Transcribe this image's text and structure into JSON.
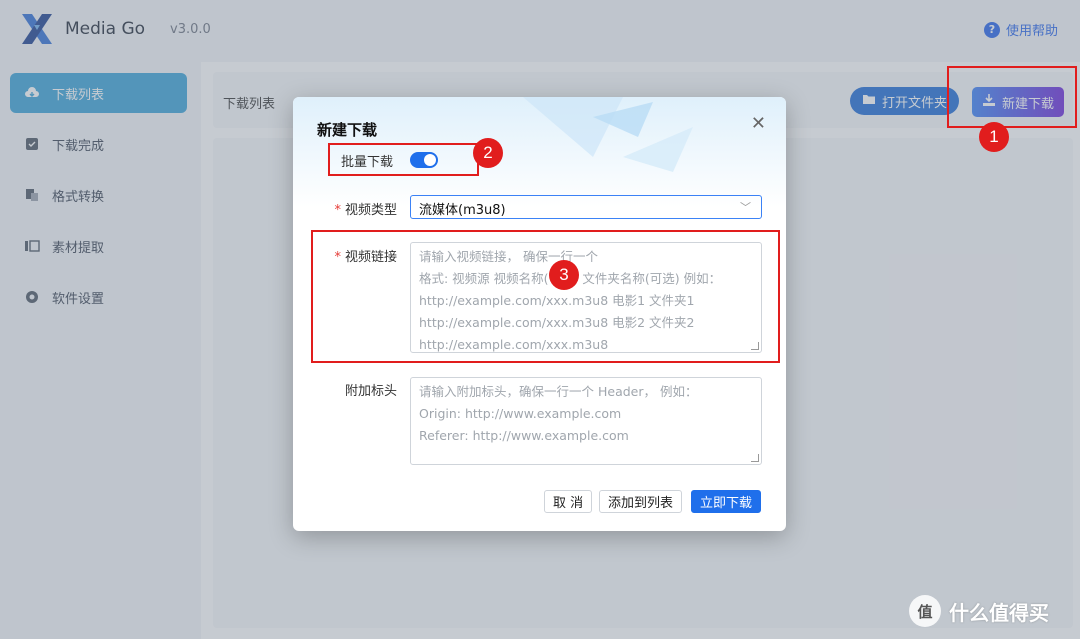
{
  "app": {
    "name": "Media Go",
    "version": "v3.0.0",
    "help_label": "使用帮助"
  },
  "sidebar": {
    "items": [
      {
        "label": "下载列表",
        "icon": "cloud-download-icon",
        "active": true
      },
      {
        "label": "下载完成",
        "icon": "checkbox-icon",
        "active": false
      },
      {
        "label": "格式转换",
        "icon": "convert-icon",
        "active": false
      },
      {
        "label": "素材提取",
        "icon": "extract-icon",
        "active": false
      },
      {
        "label": "软件设置",
        "icon": "gear-icon",
        "active": false
      }
    ]
  },
  "main": {
    "title": "下载列表",
    "open_folder_label": "打开文件夹",
    "new_download_label": "新建下载"
  },
  "dialog": {
    "title": "新建下载",
    "batch_label": "批量下载",
    "batch_enabled": true,
    "video_type_label": "视频类型",
    "video_type_value": "流媒体(m3u8)",
    "video_link_label": "视频链接",
    "video_link_placeholder_lines": [
      "请输入视频链接， 确保一行一个",
      "格式: 视频源 视频名称(可选) 文件夹名称(可选) 例如：",
      "http://example.com/xxx.m3u8 电影1 文件夹1",
      "http://example.com/xxx.m3u8 电影2 文件夹2",
      "http://example.com/xxx.m3u8"
    ],
    "header_label": "附加标头",
    "header_placeholder_lines": [
      "请输入附加标头，确保一行一个 Header， 例如：",
      "Origin: http://www.example.com",
      "Referer: http://www.example.com"
    ],
    "cancel_label": "取 消",
    "add_to_list_label": "添加到列表",
    "download_now_label": "立即下载",
    "required_mark": "*"
  },
  "annotations": {
    "one": "1",
    "two": "2",
    "three": "3"
  },
  "watermark": {
    "icon_text": "值",
    "text": "什么值得买"
  },
  "colors": {
    "accent": "#1f6feb",
    "annotation": "#e11d1d",
    "nav_active": "#3aa3d8"
  }
}
